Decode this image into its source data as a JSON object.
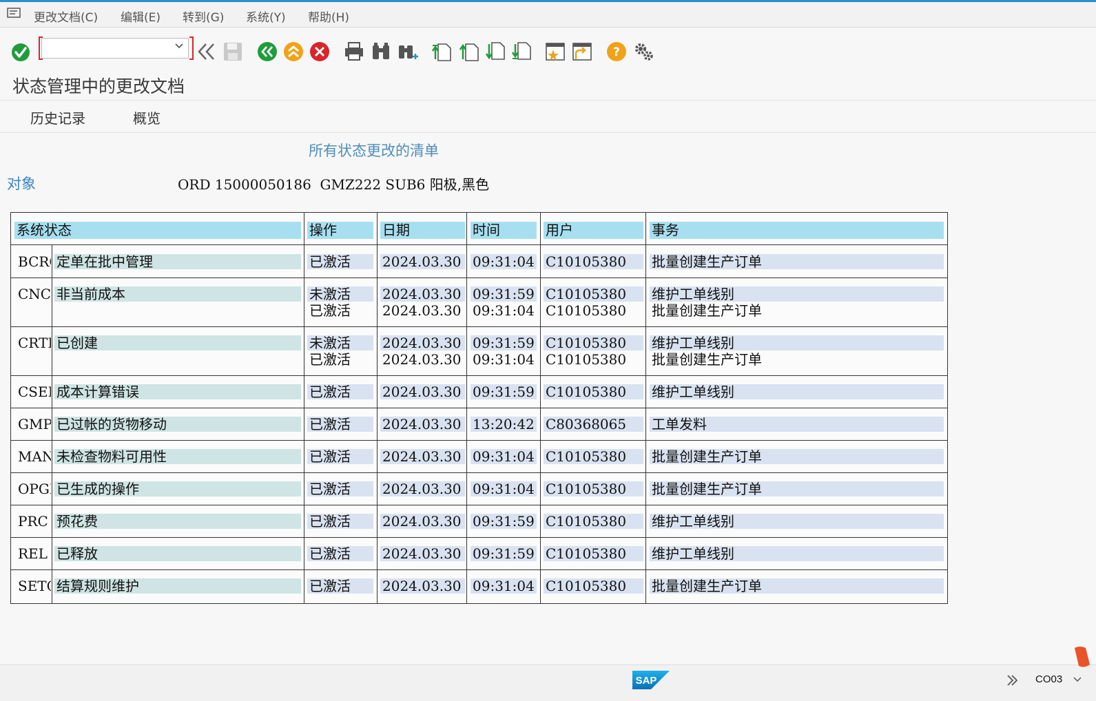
{
  "menu": {
    "items": [
      "更改文档(C)",
      "编辑(E)",
      "转到(G)",
      "系统(Y)",
      "帮助(H)"
    ]
  },
  "toolbar": {
    "command_value": "",
    "icons": [
      "enter-icon",
      "command-dropdown-icon",
      "back-double-icon",
      "save-icon",
      "back-icon",
      "exit-icon",
      "cancel-icon",
      "print-icon",
      "find-icon",
      "find-next-icon",
      "first-page-icon",
      "previous-page-icon",
      "next-page-icon",
      "last-page-icon",
      "create-session-icon",
      "shortcut-icon",
      "help-icon",
      "customize-layout-icon"
    ]
  },
  "page": {
    "title": "状态管理中的更改文档",
    "tabs": [
      "历史记录",
      "概览"
    ],
    "list_heading": "所有状态更改的清单",
    "object_label": "对象",
    "object_value": "ORD 15000050186  GMZ222 SUB6 阳极,黑色"
  },
  "table": {
    "headers": {
      "status": "系统状态",
      "action": "操作",
      "date": "日期",
      "time": "时间",
      "user": "用户",
      "transaction": "事务"
    },
    "rows": [
      {
        "code": "BCRQ",
        "desc": "定单在批中管理",
        "entries": [
          {
            "action": "已激活",
            "date": "2024.03.30",
            "time": "09:31:04",
            "user": "C10105380",
            "transaction": "批量创建生产订单"
          }
        ]
      },
      {
        "code": "CNC",
        "desc": "非当前成本",
        "entries": [
          {
            "action": "未激活",
            "date": "2024.03.30",
            "time": "09:31:59",
            "user": "C10105380",
            "transaction": "维护工单线别"
          },
          {
            "action": "已激活",
            "date": "2024.03.30",
            "time": "09:31:04",
            "user": "C10105380",
            "transaction": "批量创建生产订单"
          }
        ]
      },
      {
        "code": "CRTD",
        "desc": "已创建",
        "entries": [
          {
            "action": "未激活",
            "date": "2024.03.30",
            "time": "09:31:59",
            "user": "C10105380",
            "transaction": "维护工单线别"
          },
          {
            "action": "已激活",
            "date": "2024.03.30",
            "time": "09:31:04",
            "user": "C10105380",
            "transaction": "批量创建生产订单"
          }
        ]
      },
      {
        "code": "CSER",
        "desc": "成本计算错误",
        "entries": [
          {
            "action": "已激活",
            "date": "2024.03.30",
            "time": "09:31:59",
            "user": "C10105380",
            "transaction": "维护工单线别"
          }
        ]
      },
      {
        "code": "GMPS",
        "desc": "已过帐的货物移动",
        "entries": [
          {
            "action": "已激活",
            "date": "2024.03.30",
            "time": "13:20:42",
            "user": "C80368065",
            "transaction": "工单发料"
          }
        ]
      },
      {
        "code": "MANC",
        "desc": "未检查物料可用性",
        "entries": [
          {
            "action": "已激活",
            "date": "2024.03.30",
            "time": "09:31:04",
            "user": "C10105380",
            "transaction": "批量创建生产订单"
          }
        ]
      },
      {
        "code": "OPGN",
        "desc": "已生成的操作",
        "entries": [
          {
            "action": "已激活",
            "date": "2024.03.30",
            "time": "09:31:04",
            "user": "C10105380",
            "transaction": "批量创建生产订单"
          }
        ]
      },
      {
        "code": "PRC",
        "desc": "预花费",
        "entries": [
          {
            "action": "已激活",
            "date": "2024.03.30",
            "time": "09:31:59",
            "user": "C10105380",
            "transaction": "维护工单线别"
          }
        ]
      },
      {
        "code": "REL",
        "desc": "已释放",
        "entries": [
          {
            "action": "已激活",
            "date": "2024.03.30",
            "time": "09:31:59",
            "user": "C10105380",
            "transaction": "维护工单线别"
          }
        ]
      },
      {
        "code": "SETC",
        "desc": "结算规则维护",
        "entries": [
          {
            "action": "已激活",
            "date": "2024.03.30",
            "time": "09:31:04",
            "user": "C10105380",
            "transaction": "批量创建生产订单"
          }
        ]
      }
    ]
  },
  "statusbar": {
    "logo": "SAP",
    "tcode": "CO03"
  },
  "colors": {
    "header_bg": "#a7dff1",
    "status_cell_bg": "#cfe4e4",
    "value_cell_bg": "#d9e2f0",
    "accent": "#2a8fd0",
    "label_blue": "#3a86c4"
  }
}
